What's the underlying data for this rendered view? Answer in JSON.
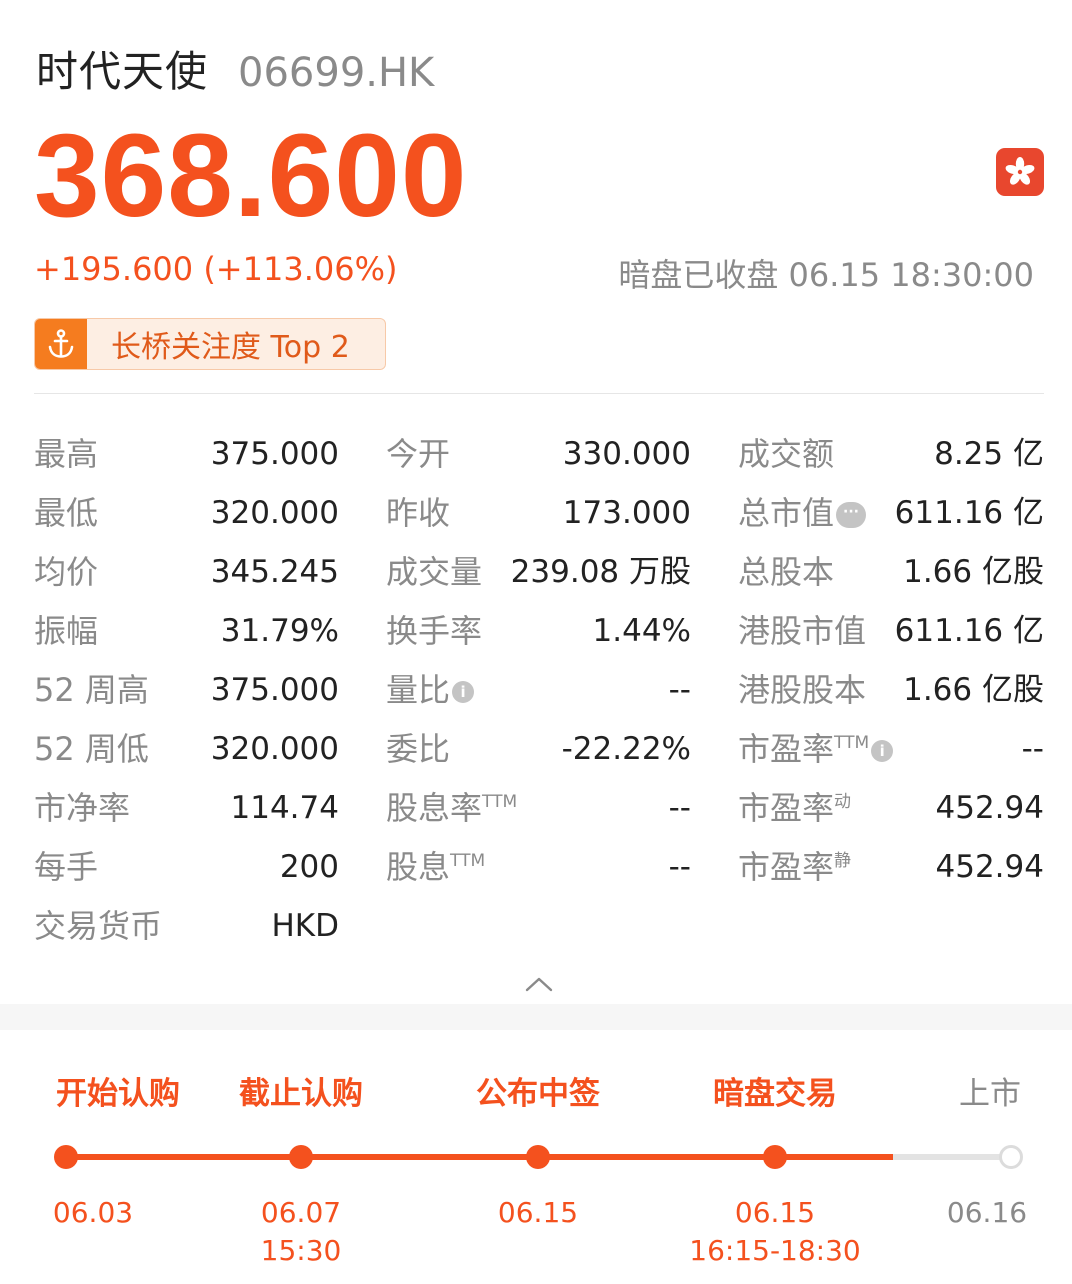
{
  "header": {
    "name": "时代天使",
    "code": "06699.HK",
    "price": "368.600",
    "change": "+195.600 (+113.06%)",
    "status": "暗盘已收盘 06.15 18:30:00",
    "accent_color": "#f4511e",
    "market_flag_icon": "hong-kong-flag-icon"
  },
  "badge": {
    "icon": "anchor-icon",
    "text": "长桥关注度 Top 2"
  },
  "stats": {
    "rows": [
      [
        [
          "最高",
          "375.000"
        ],
        [
          "今开",
          "330.000"
        ],
        [
          "成交额",
          "8.25 亿"
        ]
      ],
      [
        [
          "最低",
          "320.000"
        ],
        [
          "昨收",
          "173.000"
        ],
        [
          "总市值",
          "611.16 亿"
        ]
      ],
      [
        [
          "均价",
          "345.245"
        ],
        [
          "成交量",
          "239.08 万股"
        ],
        [
          "总股本",
          "1.66 亿股"
        ]
      ],
      [
        [
          "振幅",
          "31.79%"
        ],
        [
          "换手率",
          "1.44%"
        ],
        [
          "港股市值",
          "611.16 亿"
        ]
      ],
      [
        [
          "52 周高",
          "375.000"
        ],
        [
          "量比",
          "--"
        ],
        [
          "港股股本",
          "1.66 亿股"
        ]
      ],
      [
        [
          "52 周低",
          "320.000"
        ],
        [
          "委比",
          "-22.22%"
        ],
        [
          "市盈率",
          "--"
        ]
      ],
      [
        [
          "市净率",
          "114.74"
        ],
        [
          "股息率",
          "--"
        ],
        [
          "市盈率",
          "452.94"
        ]
      ],
      [
        [
          "每手",
          "200"
        ],
        [
          "股息",
          "--"
        ],
        [
          "市盈率",
          "452.94"
        ]
      ],
      [
        [
          "交易货币",
          "HKD"
        ]
      ]
    ],
    "superscripts": {
      "ttm": "TTM",
      "dynamic": "动",
      "static": "静"
    }
  },
  "timeline": {
    "steps": [
      {
        "label": "开始认购",
        "date": "06.03",
        "time": "",
        "done": true
      },
      {
        "label": "截止认购",
        "date": "06.07",
        "time": "15:30",
        "done": true
      },
      {
        "label": "公布中签",
        "date": "06.15",
        "time": "",
        "done": true
      },
      {
        "label": "暗盘交易",
        "date": "06.15",
        "time": "16:15-18:30",
        "done": true
      },
      {
        "label": "上市",
        "date": "06.16",
        "time": "",
        "done": false
      }
    ]
  }
}
